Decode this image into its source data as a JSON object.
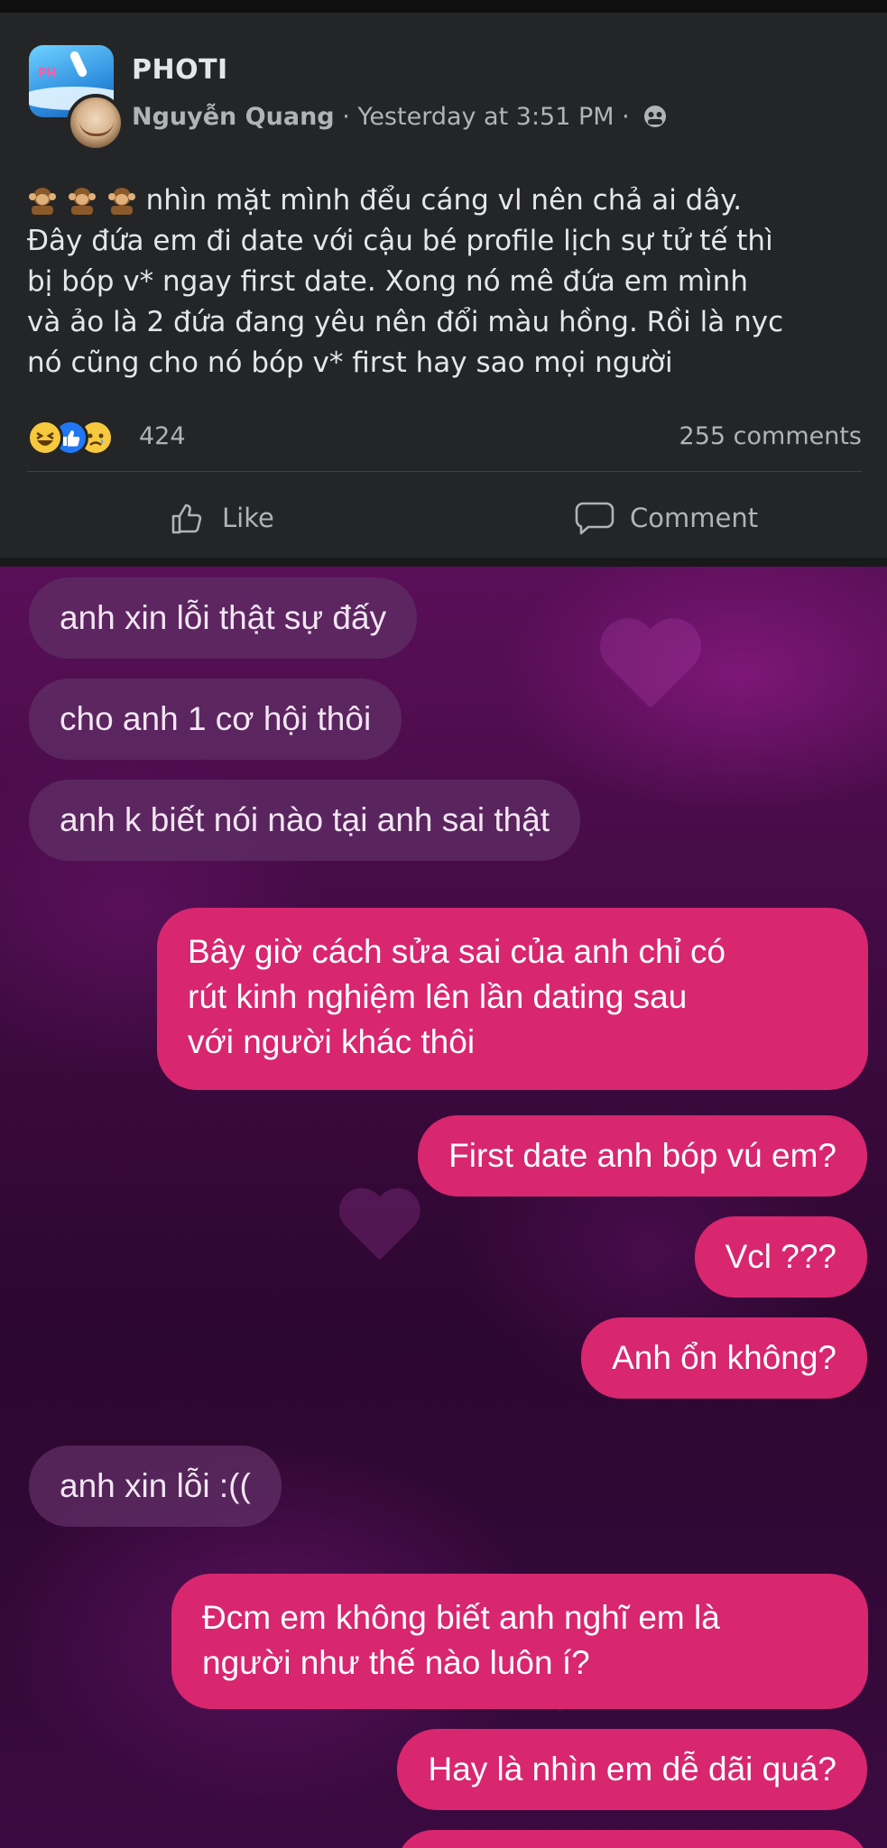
{
  "group": {
    "name": "PHOTI",
    "avatar_badge": "PH"
  },
  "post": {
    "author": "Nguyễn Quang",
    "separator": "·",
    "time": "Yesterday at 3:51 PM",
    "privacy_icon": "group-privacy-icon",
    "emoji_prefix": "hear-no-evil-monkey x3",
    "lines": [
      "nhìn mặt mình đểu cáng vl nên chả ai dây.",
      "Đây đứa em đi date với cậu bé profile lịch sự tử tế thì",
      "bị bóp v* ngay first date. Xong nó mê đứa em mình",
      "và  ảo là 2 đứa đang yêu nên đổi màu hồng. Rồi là nyc",
      "nó cũng cho nó bóp v* first hay sao mọi người"
    ]
  },
  "stats": {
    "reaction_icons": [
      "haha-icon",
      "like-icon",
      "sad-icon"
    ],
    "reaction_count": "424",
    "comment_count": "255 comments"
  },
  "actions": {
    "like_label": "Like",
    "comment_label": "Comment"
  },
  "chat": {
    "colors": {
      "incoming": "#5f2d64",
      "outgoing": "#d8266f"
    },
    "messages": [
      {
        "side": "in",
        "lines": [
          "anh xin lỗi thật sự đấy"
        ]
      },
      {
        "side": "in",
        "lines": [
          "cho anh 1 cơ hội thôi"
        ]
      },
      {
        "side": "in",
        "lines": [
          "anh k biết nói nào tại anh sai thật"
        ]
      },
      {
        "side": "out",
        "lines": [
          "Bây giờ cách sửa sai của anh chỉ có",
          "rút kinh nghiệm lên lần dating sau",
          "với người khác thôi"
        ]
      },
      {
        "side": "out",
        "lines": [
          "First date anh bóp vú em?"
        ]
      },
      {
        "side": "out",
        "lines": [
          "Vcl ???"
        ]
      },
      {
        "side": "out",
        "lines": [
          "Anh ổn không?"
        ]
      },
      {
        "side": "in",
        "lines": [
          "anh xin lỗi :(("
        ]
      },
      {
        "side": "out",
        "lines": [
          "Đcm em không biết anh nghĩ em là",
          "người như thế nào luôn í?"
        ]
      },
      {
        "side": "out",
        "lines": [
          "Hay là nhìn em dễ dãi quá?"
        ]
      }
    ]
  }
}
